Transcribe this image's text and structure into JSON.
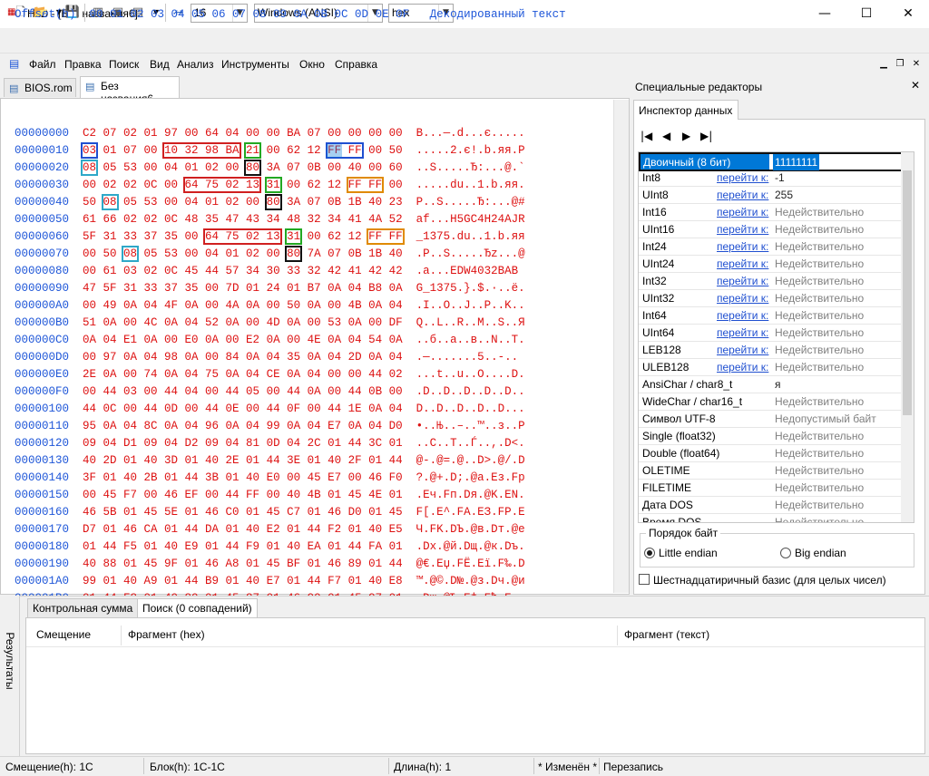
{
  "window": {
    "title": "HxD - [Без названия6]",
    "app_icon": "HxD"
  },
  "toolbar": {
    "bytes_per_row": "16",
    "charset": "Windows (ANSI)",
    "display_mode": "hex"
  },
  "menu": [
    "Файл",
    "Правка",
    "Поиск",
    "Вид",
    "Анализ",
    "Инструменты",
    "Окно",
    "Справка"
  ],
  "tabs": [
    {
      "label": "BIOS.rom",
      "active": false
    },
    {
      "label": "Без названия6",
      "active": true
    }
  ],
  "hex": {
    "header": "Offset(h)  00 01 02 03 04 05 06 07 08 09 0A 0B 0C 0D 0E 0F   Декодированный текст",
    "rows": [
      {
        "off": "00000000",
        "hex": "C2 07 02 01 97 00 64 04 00 00 BA 07 00 00 00 00",
        "txt": "B...—.d...є....."
      },
      {
        "off": "00000010",
        "hex": "03 01 07 00 10 32 98 BA 21 00 62 12 FF FF 00 50",
        "txt": ".....2.є!.b.яя.P"
      },
      {
        "off": "00000020",
        "hex": "08 05 53 00 04 01 02 00 80 3A 07 0B 00 40 00 60",
        "txt": "..S.....Ђ:...@.`"
      },
      {
        "off": "00000030",
        "hex": "00 02 02 0C 00 64 75 02 13 31 00 62 12 FF FF 00",
        "txt": ".....du..1.b.яя."
      },
      {
        "off": "00000040",
        "hex": "50 08 05 53 00 04 01 02 00 80 3A 07 0B 1B 40 23",
        "txt": "P..S.....Ђ:...@#"
      },
      {
        "off": "00000050",
        "hex": "61 66 02 02 0C 48 35 47 43 34 48 32 34 41 4A 52",
        "txt": "af...H5GC4H24AJR"
      },
      {
        "off": "00000060",
        "hex": "5F 31 33 37 35 00 64 75 02 13 31 00 62 12 FF FF",
        "txt": "_1375.du..1.b.яя"
      },
      {
        "off": "00000070",
        "hex": "00 50 08 05 53 00 04 01 02 00 80 7A 07 0B 1B 40",
        "txt": ".P..S.....Ђz...@"
      },
      {
        "off": "00000080",
        "hex": "00 61 03 02 0C 45 44 57 34 30 33 32 42 41 42 42",
        "txt": ".a...EDW4032BAB"
      },
      {
        "off": "00000090",
        "hex": "47 5F 31 33 37 35 00 7D 01 24 01 B7 0A 04 B8 0A",
        "txt": "G_1375.}.$.·..ё."
      },
      {
        "off": "000000A0",
        "hex": "00 49 0A 04 4F 0A 00 4A 0A 00 50 0A 00 4B 0A 04",
        "txt": ".I..O..J..P..K.."
      },
      {
        "off": "000000B0",
        "hex": "51 0A 00 4C 0A 04 52 0A 00 4D 0A 00 53 0A 00 DF",
        "txt": "Q..L..R..M..S..Я"
      },
      {
        "off": "000000C0",
        "hex": "0A 04 E1 0A 00 E0 0A 00 E2 0A 00 4E 0A 04 54 0A",
        "txt": "..б..а..в..N..T."
      },
      {
        "off": "000000D0",
        "hex": "00 97 0A 04 98 0A 00 84 0A 04 35 0A 04 2D 0A 04",
        "txt": ".—.......5..-.."
      },
      {
        "off": "000000E0",
        "hex": "2E 0A 00 74 0A 04 75 0A 04 CE 0A 04 00 00 44 02",
        "txt": "...t..u..O....D."
      },
      {
        "off": "000000F0",
        "hex": "00 44 03 00 44 04 00 44 05 00 44 0A 00 44 0B 00",
        "txt": ".D..D..D..D..D.."
      },
      {
        "off": "00000100",
        "hex": "44 0C 00 44 0D 00 44 0E 00 44 0F 00 44 1E 0A 04",
        "txt": "D..D..D..D..D..."
      },
      {
        "off": "00000110",
        "hex": "95 0A 04 8C 0A 04 96 0A 04 99 0A 04 E7 0A 04 D0",
        "txt": "•..Њ..–..™..з..Р"
      },
      {
        "off": "00000120",
        "hex": "09 04 D1 09 04 D2 09 04 81 0D 04 2C 01 44 3C 01",
        "txt": "..С..Т..Ѓ..,.D<."
      },
      {
        "off": "00000130",
        "hex": "40 2D 01 40 3D 01 40 2E 01 44 3E 01 40 2F 01 44",
        "txt": "@-.@=.@..D>.@/.D"
      },
      {
        "off": "00000140",
        "hex": "3F 01 40 2B 01 44 3B 01 40 E0 00 45 E7 00 46 F0",
        "txt": "?.@+.D;.@а.Eз.Fр"
      },
      {
        "off": "00000150",
        "hex": "00 45 F7 00 46 EF 00 44 FF 00 40 4B 01 45 4E 01",
        "txt": ".Eч.Fп.Dя.@K.EN."
      },
      {
        "off": "00000160",
        "hex": "46 5B 01 45 5E 01 46 C0 01 45 C7 01 46 D0 01 45",
        "txt": "F[.E^.FA.EЗ.FР.E"
      },
      {
        "off": "00000170",
        "hex": "D7 01 46 CA 01 44 DA 01 40 E2 01 44 F2 01 40 E5",
        "txt": "Ч.FK.DЪ.@в.Dт.@е"
      },
      {
        "off": "00000180",
        "hex": "01 44 F5 01 40 E9 01 44 F9 01 40 EA 01 44 FA 01",
        "txt": ".Dх.@й.Dщ.@к.Dъ."
      },
      {
        "off": "00000190",
        "hex": "40 88 01 45 9F 01 46 A8 01 45 BF 01 46 89 01 44",
        "txt": "@€.Eџ.FЁ.Eї.F‰.D"
      },
      {
        "off": "000001A0",
        "hex": "99 01 40 A9 01 44 B9 01 40 E7 01 44 F7 01 40 E8",
        "txt": "™.@©.D№.@з.Dч.@и"
      },
      {
        "off": "000001B0",
        "hex": "01 44 F8 01 40 80 01 45 87 01 46 90 01 45 97 01",
        "txt": ".Dш.@Ђ.E‡.Fђ.E—."
      },
      {
        "off": "000001C0",
        "hex": "46 A0 01 45 A7 01 46 B0 01 45 B7 01 46 E8 00 44",
        "txt": "F .E§.F°.E·.Fи.D"
      },
      {
        "off": "000001D0",
        "hex": "F8 00 40 E9 00 44 F9 00 40 EA 00 44 FA 00 40 ED",
        "txt": "ш.@й.Dщ.@к.Dъ.@н"
      },
      {
        "off": "000001E0",
        "hex": "00 44 FD 00 40 EE 00 44 FE 00 40 4F 01 44 5F 01",
        "txt": ".Dэ.@о.Dю.@O.D_."
      },
      {
        "off": "000001F0",
        "hex": "40 C8 01 44 D8 01 40 C9 01 44 D9 01 40 55 0A 04",
        "txt": "@И.DШ.@Й.DЩ.@U.."
      },
      {
        "off": "00000200",
        "hex": "56 0A 00 2F 0A 04 2F 0A 00 5F 0A 00 49 0A 04 52",
        "txt": "V../../.._..I..R"
      }
    ],
    "highlight_colors": {
      "blue": "#1f4fd0",
      "red": "#d02020",
      "green": "#22a822",
      "black": "#111111",
      "cyan": "#2ea8c8",
      "orange": "#e08a00",
      "selection": "#0078d7"
    }
  },
  "inspector": {
    "panel_title": "Специальные редакторы",
    "tab": "Инспектор данных",
    "nav": [
      "|◀",
      "◀",
      "▶",
      "▶|"
    ],
    "rows": [
      {
        "name": "Двоичный (8 бит)",
        "link": "",
        "value": "11111111",
        "selected": true
      },
      {
        "name": "Int8",
        "link": "перейти к:",
        "value": "-1"
      },
      {
        "name": "UInt8",
        "link": "перейти к:",
        "value": "255"
      },
      {
        "name": "Int16",
        "link": "перейти к:",
        "value": "Недействительно"
      },
      {
        "name": "UInt16",
        "link": "перейти к:",
        "value": "Недействительно"
      },
      {
        "name": "Int24",
        "link": "перейти к:",
        "value": "Недействительно"
      },
      {
        "name": "UInt24",
        "link": "перейти к:",
        "value": "Недействительно"
      },
      {
        "name": "Int32",
        "link": "перейти к:",
        "value": "Недействительно"
      },
      {
        "name": "UInt32",
        "link": "перейти к:",
        "value": "Недействительно"
      },
      {
        "name": "Int64",
        "link": "перейти к:",
        "value": "Недействительно"
      },
      {
        "name": "UInt64",
        "link": "перейти к:",
        "value": "Недействительно"
      },
      {
        "name": "LEB128",
        "link": "перейти к:",
        "value": "Недействительно"
      },
      {
        "name": "ULEB128",
        "link": "перейти к:",
        "value": "Недействительно"
      },
      {
        "name": "AnsiChar / char8_t",
        "link": "",
        "value": "я"
      },
      {
        "name": "WideChar / char16_t",
        "link": "",
        "value": "Недействительно"
      },
      {
        "name": "Символ UTF-8",
        "link": "",
        "value": "Недопустимый байт"
      },
      {
        "name": "Single (float32)",
        "link": "",
        "value": "Недействительно"
      },
      {
        "name": "Double (float64)",
        "link": "",
        "value": "Недействительно"
      },
      {
        "name": "OLETIME",
        "link": "",
        "value": "Недействительно"
      },
      {
        "name": "FILETIME",
        "link": "",
        "value": "Недействительно"
      },
      {
        "name": "Дата DOS",
        "link": "",
        "value": "Недействительно"
      },
      {
        "name": "Время DOS",
        "link": "",
        "value": "Недействительно"
      }
    ],
    "byte_order": {
      "label": "Порядок байт",
      "little": "Little endian",
      "big": "Big endian",
      "selected": "little"
    },
    "hex_basis": "Шестнадцатиричный базис (для целых чисел)"
  },
  "bottom": {
    "side_label": "Результаты",
    "tabs": [
      {
        "label": "Контрольная сумма",
        "active": false
      },
      {
        "label": "Поиск (0 совпадений)",
        "active": true
      }
    ],
    "columns": [
      "Смещение",
      "Фрагмент (hex)",
      "Фрагмент (текст)"
    ]
  },
  "status": {
    "offset": "Смещение(h): 1C",
    "block": "Блок(h): 1C-1C",
    "length": "Длина(h): 1",
    "modified": "* Изменён *",
    "mode": "Перезапись"
  }
}
